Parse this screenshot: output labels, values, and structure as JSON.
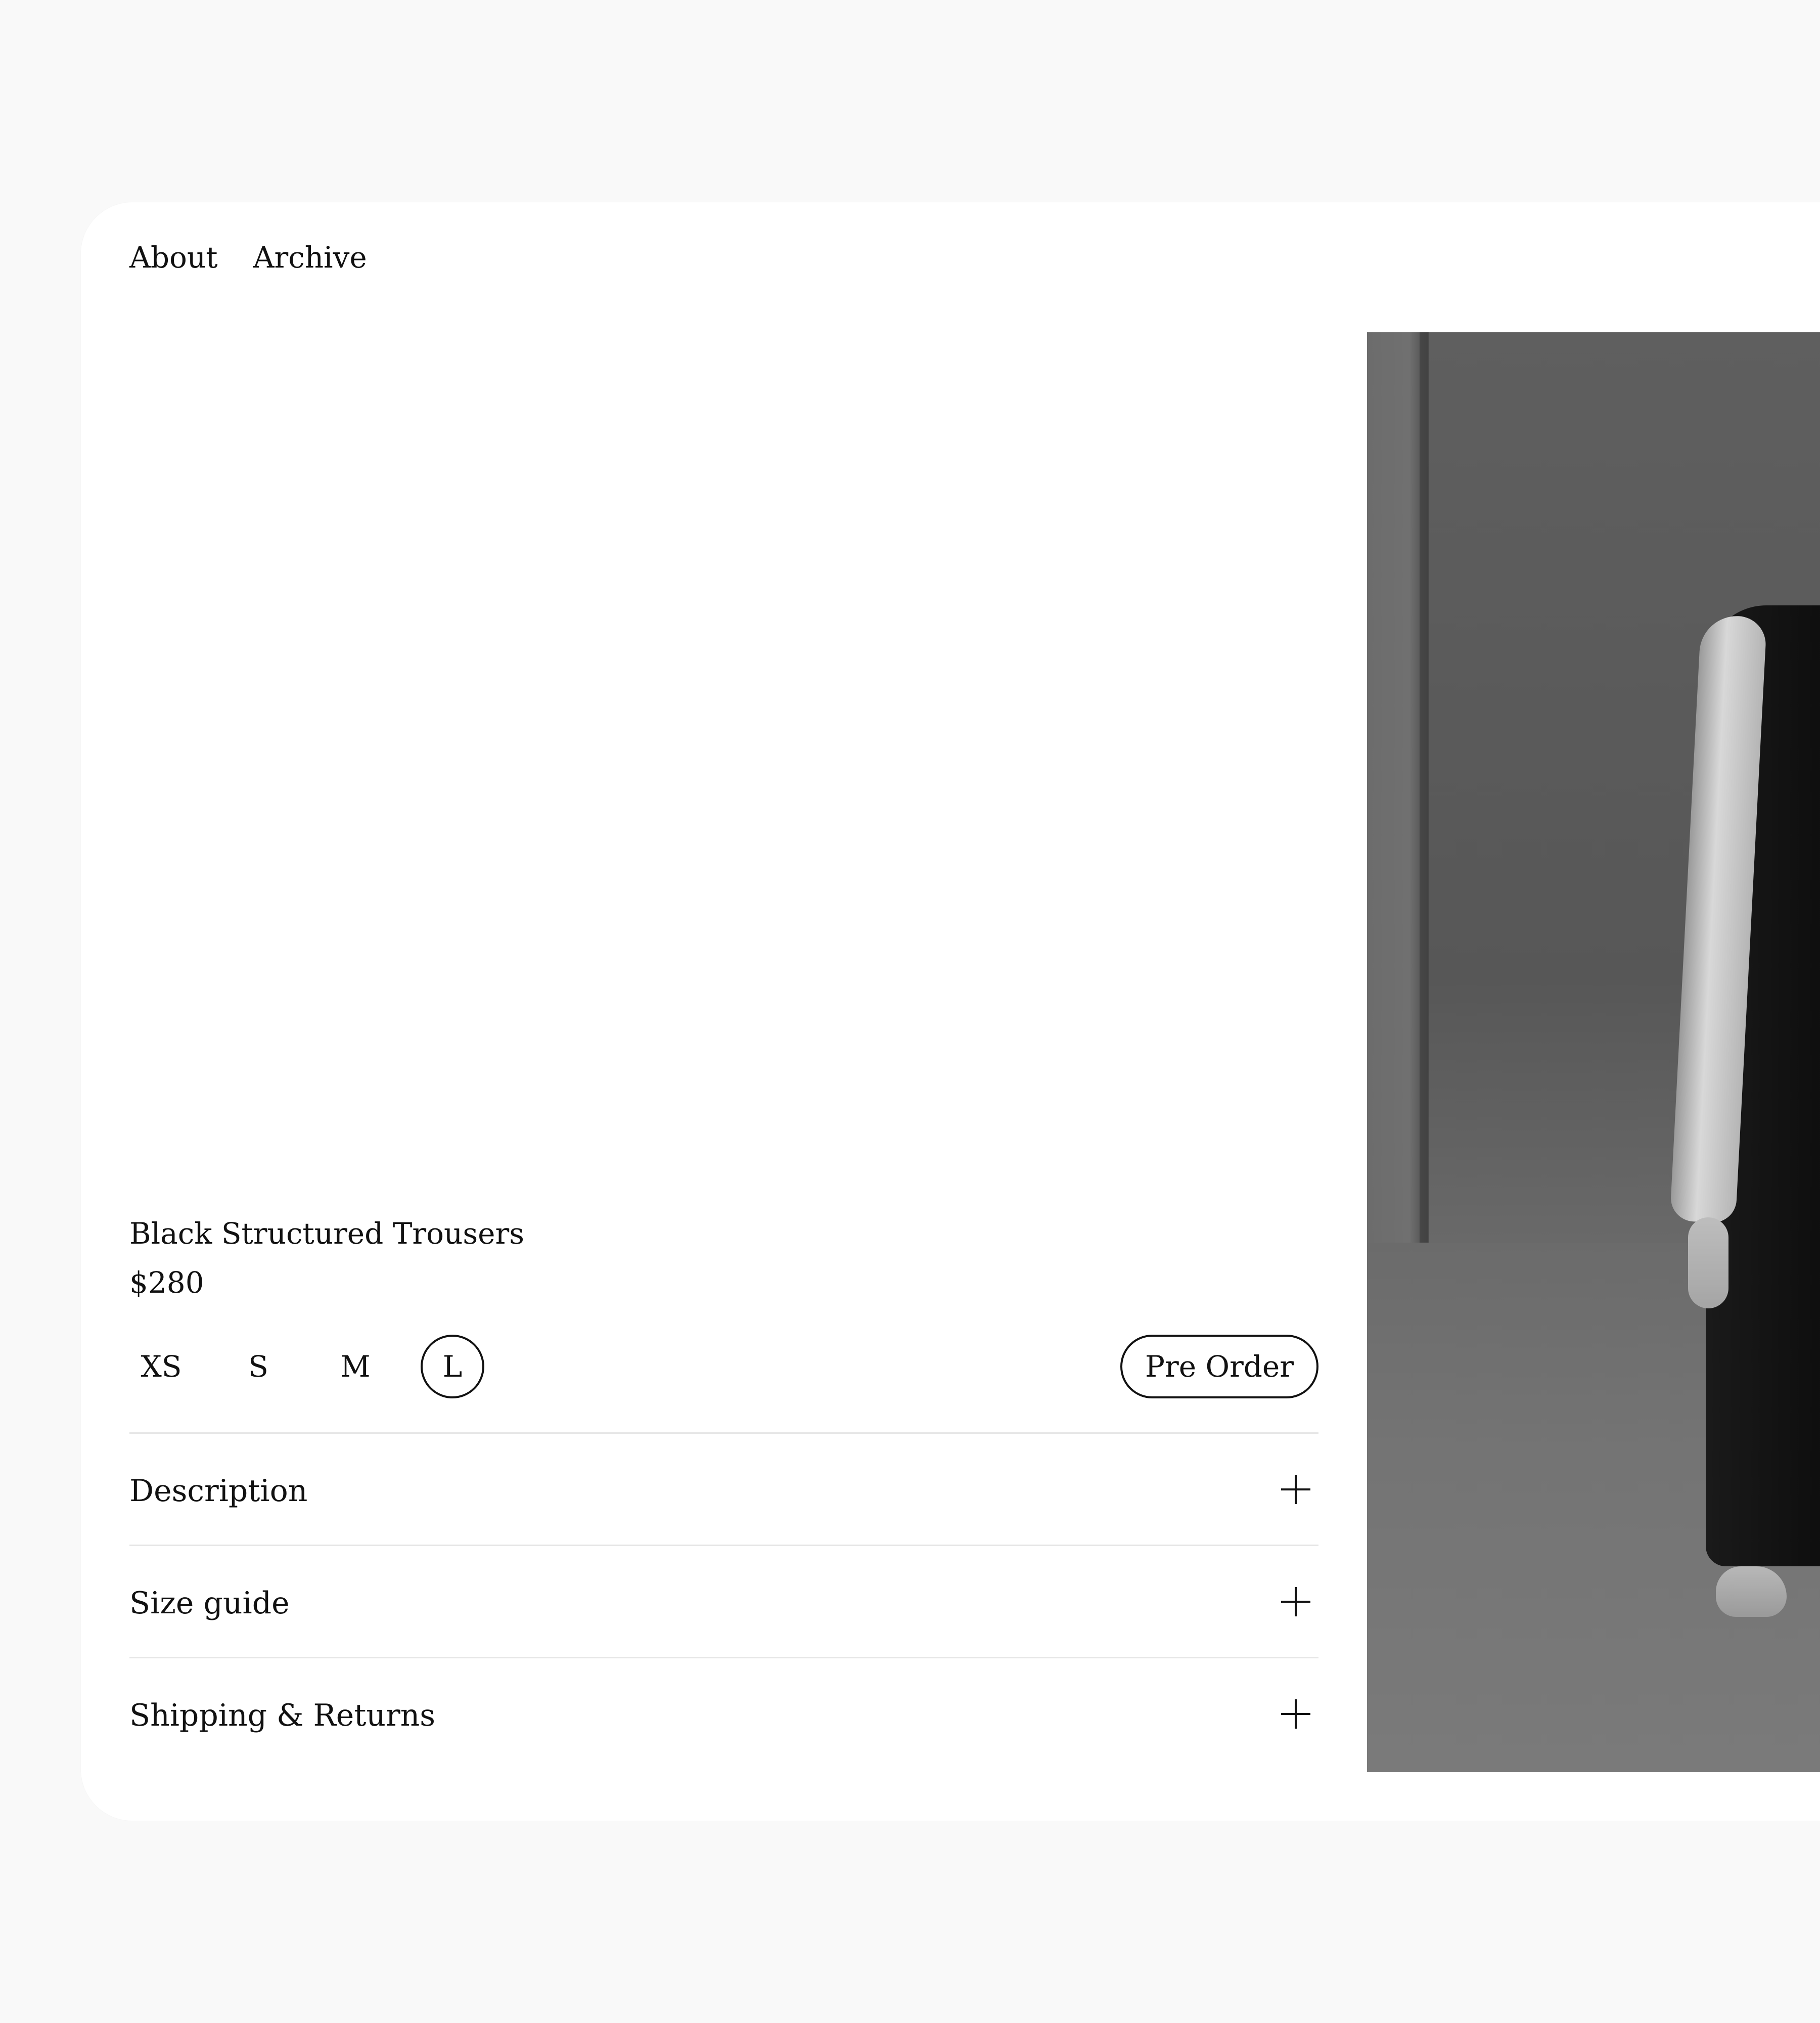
{
  "nav": {
    "items": [
      {
        "label": "About"
      },
      {
        "label": "Archive"
      }
    ]
  },
  "product": {
    "title": "Black Structured Trousers",
    "price": "$280",
    "sizes": [
      {
        "label": "XS",
        "selected": false
      },
      {
        "label": "S",
        "selected": false
      },
      {
        "label": "M",
        "selected": false
      },
      {
        "label": "L",
        "selected": true
      }
    ],
    "preorder_label": "Pre Order"
  },
  "accordion": [
    {
      "label": "Description",
      "icon": "plus-icon"
    },
    {
      "label": "Size guide",
      "icon": "plus-icon"
    },
    {
      "label": "Shipping & Returns",
      "icon": "plus-icon"
    }
  ],
  "colors": {
    "page_background": "#f9f9f9",
    "card_background": "#ffffff",
    "text": "#111111",
    "divider": "#e6e6e6"
  }
}
